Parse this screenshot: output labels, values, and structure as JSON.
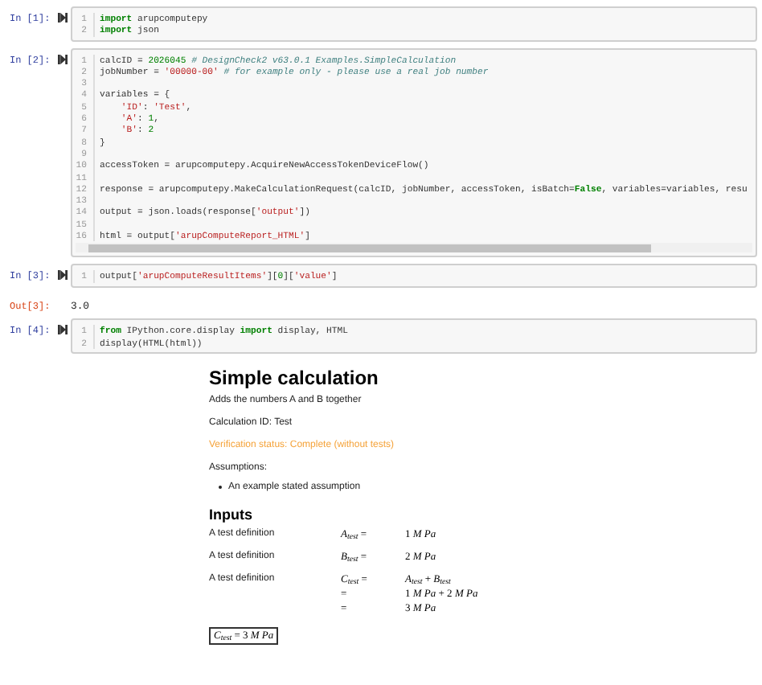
{
  "cells": [
    {
      "prompt": "In [1]:",
      "kind": "code",
      "lines": [
        {
          "number": "1",
          "tokens": [
            {
              "kind": "keyword",
              "text": "import"
            },
            {
              "kind": "plain",
              "text": " arupcomputepy"
            }
          ]
        },
        {
          "number": "2",
          "tokens": [
            {
              "kind": "keyword",
              "text": "import"
            },
            {
              "kind": "plain",
              "text": " json"
            }
          ]
        }
      ]
    },
    {
      "prompt": "In [2]:",
      "kind": "code",
      "scrollbar": true,
      "lines": [
        {
          "number": "1",
          "tokens": [
            {
              "kind": "plain",
              "text": "calcID = "
            },
            {
              "kind": "number",
              "text": "2026045"
            },
            {
              "kind": "comment",
              "text": " # DesignCheck2 v63.0.1 Examples.SimpleCalculation"
            }
          ]
        },
        {
          "number": "2",
          "tokens": [
            {
              "kind": "plain",
              "text": "jobNumber = "
            },
            {
              "kind": "string",
              "text": "'00000-00'"
            },
            {
              "kind": "comment",
              "text": " # for example only - please use a real job number"
            }
          ]
        },
        {
          "number": "3"
        },
        {
          "number": "4",
          "tokens": [
            {
              "kind": "plain",
              "text": "variables = {"
            }
          ]
        },
        {
          "number": "5",
          "tokens": [
            {
              "kind": "string",
              "text": "    'ID'"
            },
            {
              "kind": "plain",
              "text": ": "
            },
            {
              "kind": "string",
              "text": "'Test'"
            },
            {
              "kind": "plain",
              "text": ","
            }
          ]
        },
        {
          "number": "6",
          "tokens": [
            {
              "kind": "string",
              "text": "    'A'"
            },
            {
              "kind": "plain",
              "text": ": "
            },
            {
              "kind": "number",
              "text": "1"
            },
            {
              "kind": "plain",
              "text": ","
            }
          ]
        },
        {
          "number": "7",
          "tokens": [
            {
              "kind": "string",
              "text": "    'B'"
            },
            {
              "kind": "plain",
              "text": ": "
            },
            {
              "kind": "number",
              "text": "2"
            }
          ]
        },
        {
          "number": "8",
          "tokens": [
            {
              "kind": "plain",
              "text": "}"
            }
          ]
        },
        {
          "number": "9"
        },
        {
          "number": "10",
          "tokens": [
            {
              "kind": "plain",
              "text": "accessToken = arupcomputepy.AcquireNewAccessTokenDeviceFlow()"
            }
          ]
        },
        {
          "number": "11"
        },
        {
          "number": "12",
          "tokens": [
            {
              "kind": "plain",
              "text": "response = arupcomputepy.MakeCalculationRequest(calcID, jobNumber, accessToken, isBatch="
            },
            {
              "kind": "keyword",
              "text": "False"
            },
            {
              "kind": "plain",
              "text": ", variables=variables, resu"
            }
          ]
        },
        {
          "number": "13"
        },
        {
          "number": "14",
          "tokens": [
            {
              "kind": "plain",
              "text": "output = json.loads(response["
            },
            {
              "kind": "string",
              "text": "'output'"
            },
            {
              "kind": "plain",
              "text": "])"
            }
          ]
        },
        {
          "number": "15"
        },
        {
          "number": "16",
          "tokens": [
            {
              "kind": "plain",
              "text": "html = output["
            },
            {
              "kind": "string",
              "text": "'arupComputeReport_HTML'"
            },
            {
              "kind": "plain",
              "text": "]"
            }
          ]
        }
      ]
    },
    {
      "prompt": "In [3]:",
      "kind": "code",
      "lines": [
        {
          "number": "1",
          "tokens": [
            {
              "kind": "plain",
              "text": "output["
            },
            {
              "kind": "string",
              "text": "'arupComputeResultItems'"
            },
            {
              "kind": "plain",
              "text": "]["
            },
            {
              "kind": "number",
              "text": "0"
            },
            {
              "kind": "plain",
              "text": "]["
            },
            {
              "kind": "string",
              "text": "'value'"
            },
            {
              "kind": "plain",
              "text": "]"
            }
          ]
        }
      ]
    },
    {
      "prompt": "Out[3]:",
      "kind": "output",
      "text": "3.0"
    },
    {
      "prompt": "In [4]:",
      "kind": "code",
      "lines": [
        {
          "number": "1",
          "tokens": [
            {
              "kind": "keyword",
              "text": "from"
            },
            {
              "kind": "plain",
              "text": " IPython.core.display "
            },
            {
              "kind": "keyword",
              "text": "import"
            },
            {
              "kind": "plain",
              "text": " display, HTML"
            }
          ]
        },
        {
          "number": "2",
          "tokens": [
            {
              "kind": "plain",
              "text": "display(HTML(html))"
            }
          ]
        }
      ]
    }
  ],
  "report": {
    "title": "Simple calculation",
    "description": "Adds the numbers A and B together",
    "calculation_id": "Calculation ID: Test",
    "verification_status": "Verification status: Complete (without tests)",
    "assumptions_heading": "Assumptions:",
    "assumptions": [
      "An example stated assumption"
    ],
    "inputs_heading": "Inputs",
    "inputs": [
      {
        "label": "A test definition",
        "lines": [
          {
            "lhs": "*A*$_{test}$ =",
            "rhs": "1 *M Pa*"
          }
        ]
      },
      {
        "label": "A test definition",
        "lines": [
          {
            "lhs": "*B*$_{test}$ =",
            "rhs": "2 *M Pa*"
          }
        ]
      },
      {
        "label": "A test definition",
        "lines": [
          {
            "lhs": "*C*$_{test}$ =",
            "rhs": "*A*$_{test}$ + *B*$_{test}$"
          },
          {
            "lhs": "=",
            "rhs": "1 *M Pa* + 2 *M Pa*"
          },
          {
            "lhs": "=",
            "rhs": "3 *M Pa*"
          }
        ]
      }
    ],
    "result": "*C*$_{test}$ = 3 *M Pa*"
  }
}
